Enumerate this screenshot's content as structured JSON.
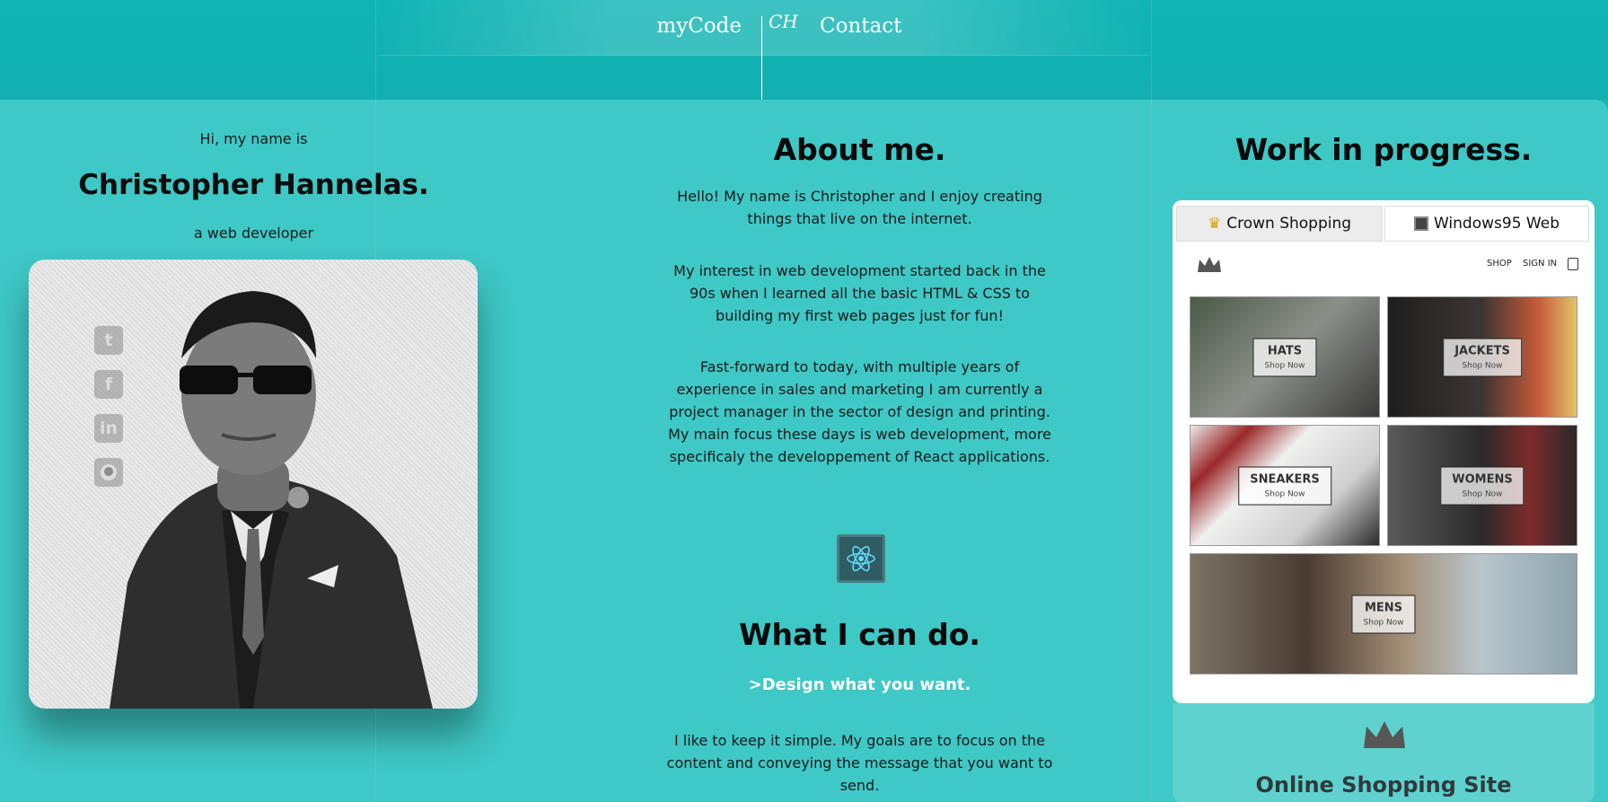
{
  "header": {
    "nav_left": "myCode",
    "logo": "CH",
    "nav_right": "Contact"
  },
  "intro": {
    "greeting": "Hi, my name is",
    "name": "Christopher Hannelas.",
    "role": "a web developer",
    "social_icons": [
      "twitter-icon",
      "facebook-icon",
      "linkedin-icon",
      "github-icon"
    ]
  },
  "about": {
    "title": "About me.",
    "p1": "Hello! My name is Christopher and I enjoy creating things that live on the internet.",
    "p2": "My interest in web development started back in the 90s when I learned all the basic HTML & CSS to building my first web pages just for fun!",
    "p3": "Fast-forward to today, with multiple years of experience in sales and marketing I am currently a project manager in the sector of design and printing. My main focus these days is web development, more specificaly the developpement of React applications.",
    "skill_icon": "react-icon"
  },
  "cando": {
    "title": "What I can do.",
    "subtitle": ">Design what you want.",
    "p1": "I like to keep it simple. My goals are to focus on the content and conveying the message that you want to send."
  },
  "work": {
    "title": "Work in progress.",
    "tabs": [
      {
        "label": "Crown Shopping",
        "icon": "crown-icon"
      },
      {
        "label": "Windows95 Web",
        "icon": "floppy-icon"
      }
    ],
    "shop_nav": {
      "shop": "SHOP",
      "signin": "SIGN IN"
    },
    "tiles": [
      {
        "title": "HATS",
        "cta": "Shop Now"
      },
      {
        "title": "JACKETS",
        "cta": "Shop Now"
      },
      {
        "title": "SNEAKERS",
        "cta": "Shop Now"
      },
      {
        "title": "WOMENS",
        "cta": "Shop Now"
      },
      {
        "title": "MENS",
        "cta": "Shop Now"
      }
    ],
    "project_title": "Online Shopping Site"
  },
  "colors": {
    "background": "#3ec8c6",
    "header": "#10b4b4",
    "accent_white": "#ffffff"
  }
}
